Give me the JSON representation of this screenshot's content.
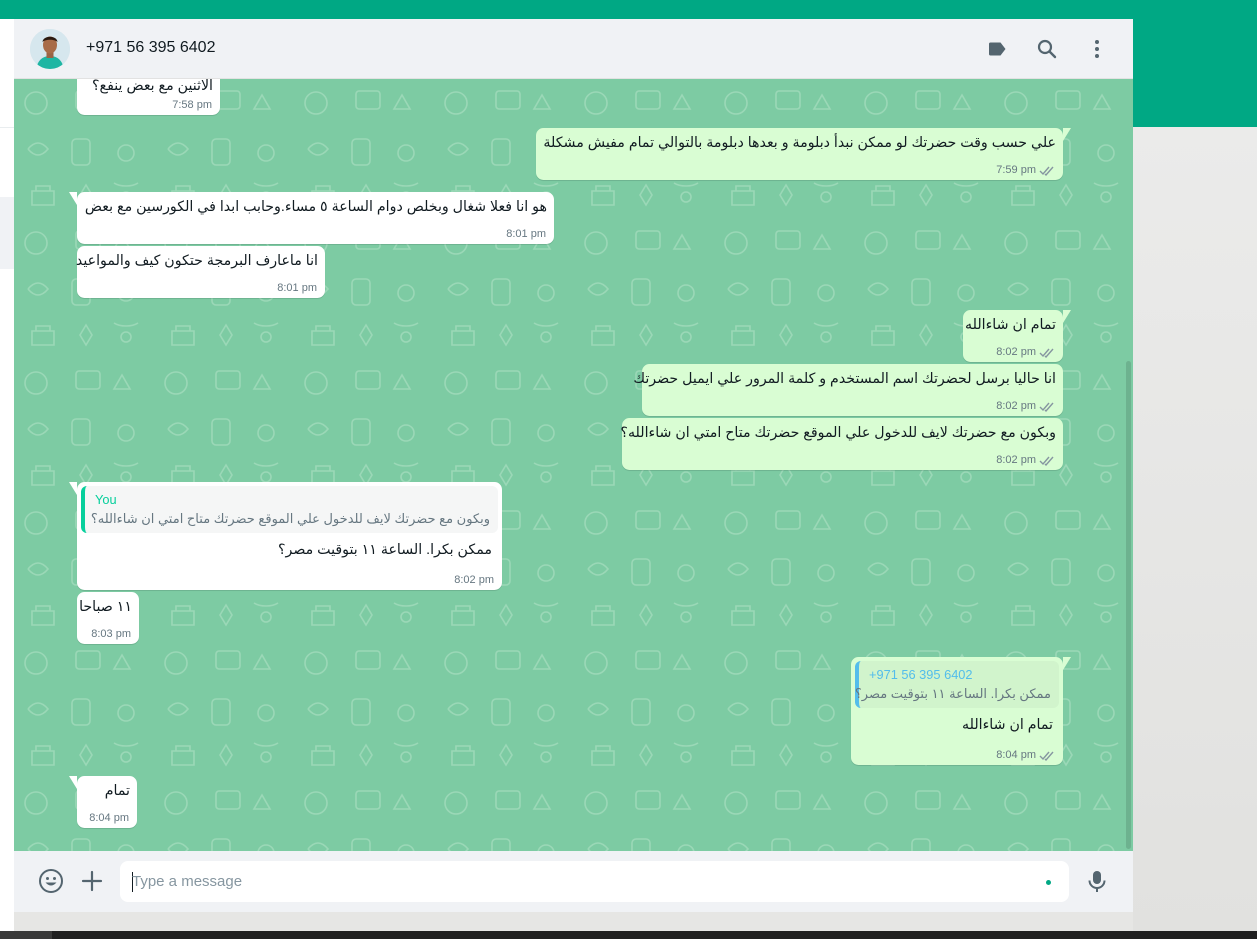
{
  "header": {
    "contact_name": "+971 56 395 6402",
    "icons": [
      "avatar",
      "label-icon",
      "search-icon",
      "menu-icon"
    ]
  },
  "messages": [
    {
      "dir": "in",
      "text": "الاثنين مع بعض ينفع؟",
      "time": "7:58 pm"
    },
    {
      "dir": "out",
      "text": "علي حسب وقت حضرتك لو ممكن نبدأ دبلومة و بعدها دبلومة بالتوالي تمام مفيش مشكلة",
      "time": "7:59 pm"
    },
    {
      "dir": "in",
      "text": "هو انا فعلا شغال وبخلص دوام الساعة ٥ مساء.وحابب ابدا في الكورسين مع بعض",
      "time": "8:01 pm"
    },
    {
      "dir": "in",
      "text": "انا ماعارف البرمجة حتكون كيف والمواعيد",
      "time": "8:01 pm"
    },
    {
      "dir": "out",
      "text": "تمام ان شاءالله",
      "time": "8:02 pm"
    },
    {
      "dir": "out",
      "text": "انا حاليا برسل لحضرتك اسم المستخدم و كلمة المرور علي ايميل حضرتك",
      "time": "8:02 pm"
    },
    {
      "dir": "out",
      "text": "وبكون مع حضرتك لايف للدخول علي الموقع حضرتك متاح امتي ان شاءالله؟",
      "time": "8:02 pm"
    },
    {
      "dir": "in",
      "quote_name": "You",
      "quote_text": "وبكون مع حضرتك لايف للدخول علي الموقع حضرتك متاح امتي ان شاءالله؟",
      "text": "ممكن بكرا. الساعة ١١ بتوقيت مصر؟",
      "time": "8:02 pm"
    },
    {
      "dir": "in",
      "text": "١١ صباحا",
      "time": "8:03 pm"
    },
    {
      "dir": "out",
      "quote_name": "+971 56 395 6402",
      "quote_text": "ممكن بكرا. الساعة ١١ بتوقيت مصر؟",
      "text": "تمام ان شاءالله",
      "time": "8:04 pm"
    },
    {
      "dir": "in",
      "text": "تمام",
      "time": "8:04 pm"
    }
  ],
  "composer": {
    "placeholder": "Type a message",
    "icons": [
      "emoji-icon",
      "attach-icon",
      "mic-icon"
    ]
  },
  "colors": {
    "brand": "#00a884",
    "wallpaper": "#7dcba3",
    "incoming_bubble": "#ffffff",
    "outgoing_bubble": "#d9fdd3",
    "quote_you": "#06cf9c",
    "quote_contact": "#53bdeb"
  }
}
